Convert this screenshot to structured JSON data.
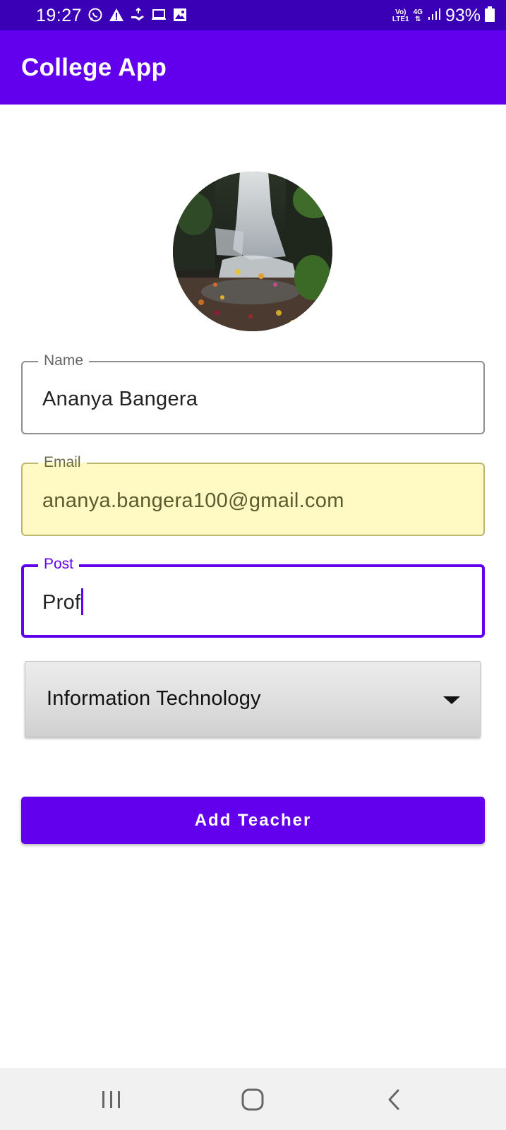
{
  "status_bar": {
    "time": "19:27",
    "network_top": "Vo)",
    "network_bottom": "LTE1",
    "network_type": "4G",
    "battery": "93%",
    "left_icons": [
      "whatsapp-icon",
      "warning-icon",
      "hand-share-icon",
      "laptop-icon",
      "gallery-icon"
    ]
  },
  "app_bar": {
    "title": "College App",
    "color": "#6200ee"
  },
  "form": {
    "name": {
      "label": "Name",
      "value": "Ananya Bangera"
    },
    "email": {
      "label": "Email",
      "value": "ananya.bangera100@gmail.com"
    },
    "post": {
      "label": "Post",
      "value": "Prof"
    },
    "department": {
      "selected": "Information Technology"
    }
  },
  "actions": {
    "add_label": "Add Teacher"
  },
  "nav": {
    "icons": [
      "recent-apps-icon",
      "home-icon",
      "back-icon"
    ]
  }
}
